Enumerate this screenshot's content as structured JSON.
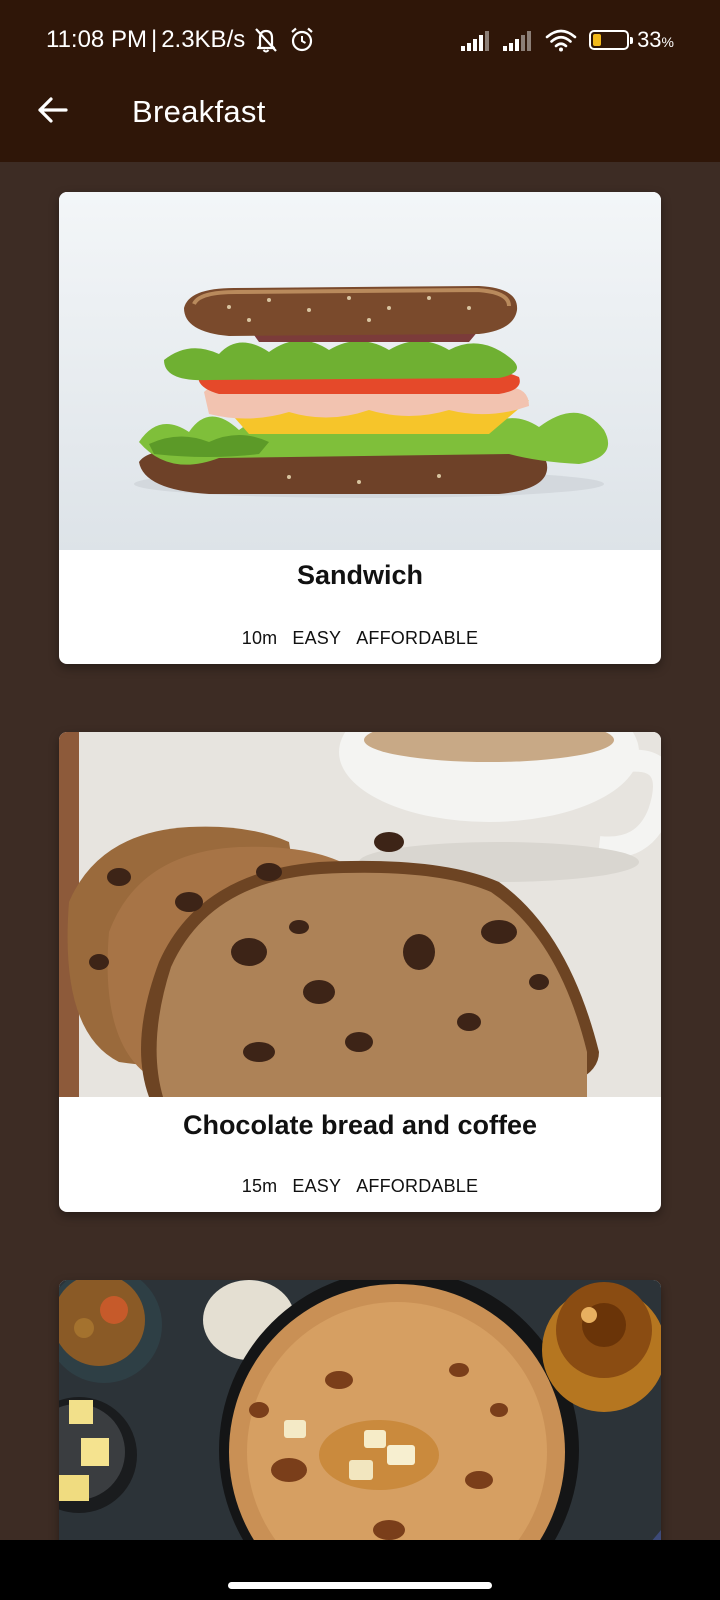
{
  "status_bar": {
    "time": "11:08 PM",
    "separator": "|",
    "net_speed": "2.3KB/s",
    "battery_number": "33",
    "battery_unit": "%",
    "battery_level": 0.33,
    "battery_color": "#f2b91b"
  },
  "header": {
    "title": "Breakfast",
    "background": "#2f1608",
    "back_icon": "arrow-left-icon"
  },
  "content": {
    "background": "#3d2c24"
  },
  "meals": [
    {
      "title": "Sandwich",
      "duration": "10m",
      "complexity": "EASY",
      "affordability": "AFFORDABLE",
      "image": "sandwich-photo"
    },
    {
      "title": "Chocolate bread and coffee",
      "duration": "15m",
      "complexity": "EASY",
      "affordability": "AFFORDABLE",
      "image": "chocolate-bread-coffee-photo"
    },
    {
      "title": "",
      "image": "paratha-with-butter-photo"
    }
  ]
}
